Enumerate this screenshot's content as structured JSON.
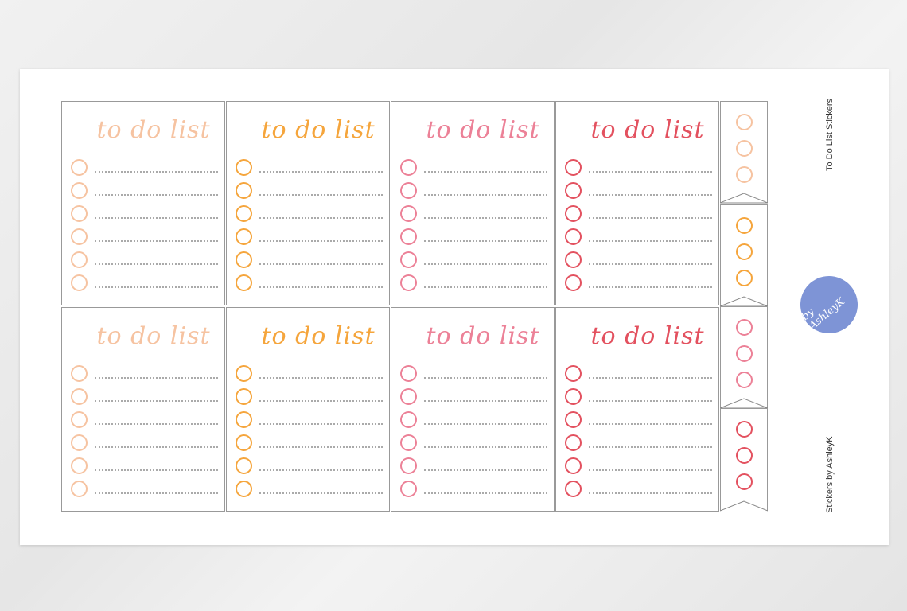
{
  "sheet": {
    "product_title": "To Do List Stickers",
    "brand_credit": "Stickers by AshleyK",
    "logo_text": "by AshleyK"
  },
  "card_title": "to do list",
  "items_per_card": 6,
  "colors": [
    "#f6c3a1",
    "#f5a53c",
    "#ec8197",
    "#e3515f"
  ],
  "flag_colors": [
    "#f6c3a1",
    "#f5a53c",
    "#ec8197",
    "#e3515f"
  ],
  "circles_per_flag": 3
}
